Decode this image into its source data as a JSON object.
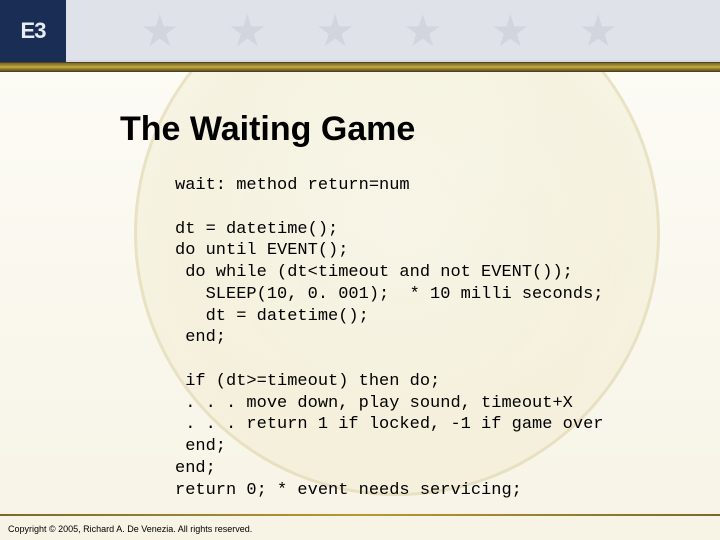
{
  "logo": {
    "text": "E3"
  },
  "title": "The Waiting Game",
  "code": {
    "l1": "wait: method return=num",
    "l2": "",
    "l3": "dt = datetime();",
    "l4": "do until EVENT();",
    "l5": " do while (dt<timeout and not EVENT());",
    "l6": "   SLEEP(10, 0. 001);  * 10 milli seconds;",
    "l7": "   dt = datetime();",
    "l8": " end;",
    "l9": "",
    "l10": " if (dt>=timeout) then do;",
    "l11": " . . . move down, play sound, timeout+X",
    "l12": " . . . return 1 if locked, -1 if game over",
    "l13": " end;",
    "l14": "end;",
    "l15": "return 0; * event needs servicing;"
  },
  "footer": {
    "copyright": "Copyright © 2005, Richard A. De Venezia. All rights reserved."
  }
}
